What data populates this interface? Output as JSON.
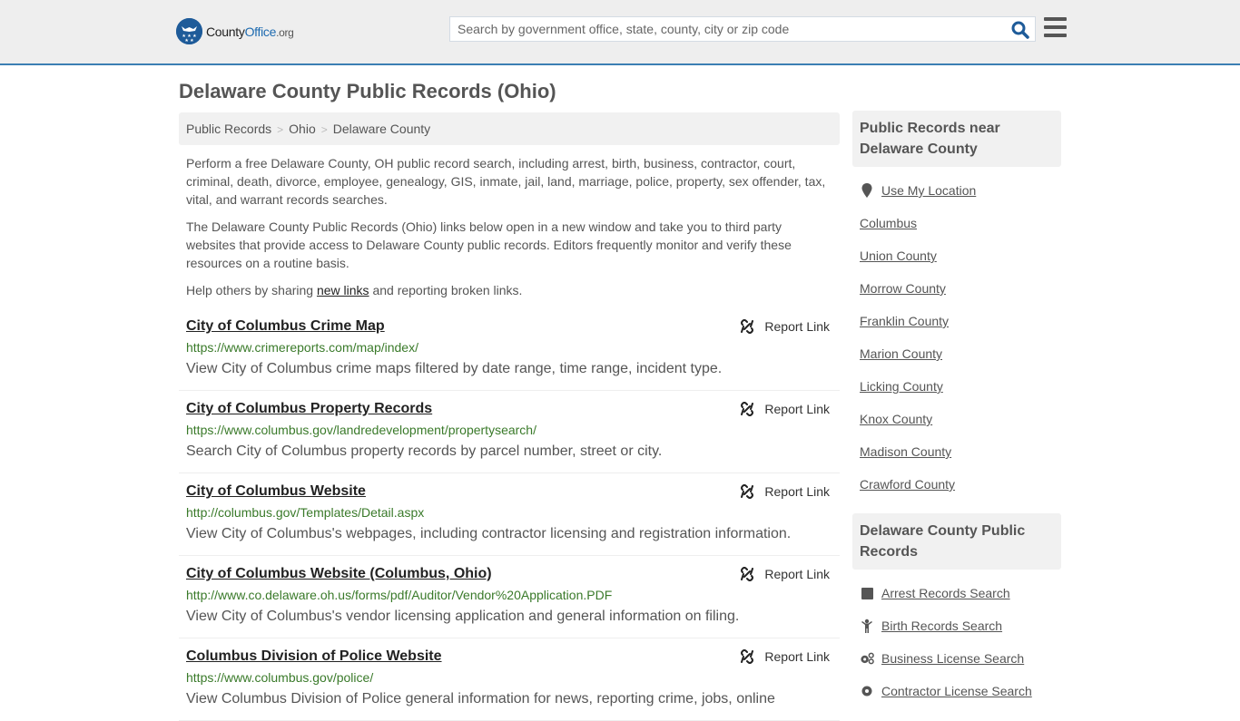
{
  "header": {
    "logo_text_1": "County",
    "logo_text_2": "Office",
    "logo_text_3": ".org",
    "search_placeholder": "Search by government office, state, county, city or zip code",
    "search_value": "",
    "search_icon": "search-icon",
    "menu_icon": "hamburger-menu-icon"
  },
  "page": {
    "title": "Delaware County Public Records (Ohio)"
  },
  "breadcrumb": [
    {
      "label": "Public Records"
    },
    {
      "label": "Ohio"
    },
    {
      "label": "Delaware County"
    }
  ],
  "breadcrumb_separator": ">",
  "intro": {
    "p1": "Perform a free Delaware County, OH public record search, including arrest, birth, business, contractor, court, criminal, death, divorce, employee, genealogy, GIS, inmate, jail, land, marriage, police, property, sex offender, tax, vital, and warrant records searches.",
    "p2": "The Delaware County Public Records (Ohio) links below open in a new window and take you to third party websites that provide access to Delaware County public records. Editors frequently monitor and verify these resources on a routine basis.",
    "p3_before": "Help others by sharing ",
    "p3_link": "new links",
    "p3_after": " and reporting broken links."
  },
  "report_label": "Report Link",
  "results": [
    {
      "title": "City of Columbus Crime Map",
      "url": "https://www.crimereports.com/map/index/",
      "description": "View City of Columbus crime maps filtered by date range, time range, incident type."
    },
    {
      "title": "City of Columbus Property Records",
      "url": "https://www.columbus.gov/landredevelopment/propertysearch/",
      "description": "Search City of Columbus property records by parcel number, street or city."
    },
    {
      "title": "City of Columbus Website",
      "url": "http://columbus.gov/Templates/Detail.aspx",
      "description": "View City of Columbus's webpages, including contractor licensing and registration information."
    },
    {
      "title": "City of Columbus Website (Columbus, Ohio)",
      "url": "http://www.co.delaware.oh.us/forms/pdf/Auditor/Vendor%20Application.PDF",
      "description": "View City of Columbus's vendor licensing application and general information on filing."
    },
    {
      "title": "Columbus Division of Police Website",
      "url": "https://www.columbus.gov/police/",
      "description": "View Columbus Division of Police general information for news, reporting crime, jobs, online"
    }
  ],
  "sidebar": {
    "nearby_heading": "Public Records near Delaware County",
    "use_location": "Use My Location",
    "nearby": [
      {
        "label": "Columbus"
      },
      {
        "label": "Union County"
      },
      {
        "label": "Morrow County"
      },
      {
        "label": "Franklin County"
      },
      {
        "label": "Marion County"
      },
      {
        "label": "Licking County"
      },
      {
        "label": "Knox County"
      },
      {
        "label": "Madison County"
      },
      {
        "label": "Crawford County"
      }
    ],
    "records_heading": "Delaware County Public Records",
    "records": [
      {
        "label": "Arrest Records Search",
        "icon": "square-icon"
      },
      {
        "label": "Birth Records Search",
        "icon": "child-icon"
      },
      {
        "label": "Business License Search",
        "icon": "gears-icon"
      },
      {
        "label": "Contractor License Search",
        "icon": "gear-icon"
      }
    ]
  },
  "colors": {
    "header_bg": "#eeeeee",
    "header_border": "#3b7fb3",
    "brand_blue": "#1e5b99",
    "url_green": "#3a7a2a",
    "text_gray": "#555555"
  }
}
